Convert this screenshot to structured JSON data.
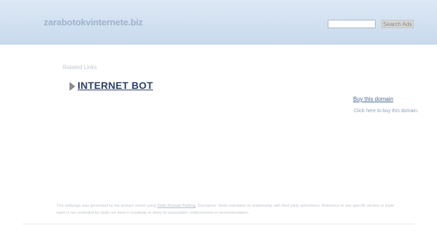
{
  "header": {
    "domain_title": "zarabotokvinternete.biz",
    "search_button_label": "Search Ads",
    "search_value": ""
  },
  "main": {
    "related_heading": "Related Links",
    "links": [
      {
        "label": "INTERNET BOT"
      }
    ]
  },
  "sidebar": {
    "buy_link": "Buy this domain",
    "buy_description": "Click here to buy this domain."
  },
  "footer": {
    "text_before_link": "This webpage was generated by the domain owner using ",
    "link_label": "Sedo Domain Parking",
    "text_after_link": ". Disclaimer: Sedo maintains no relationship with third party advertisers. Reference to any specific service or trade mark is not controlled by Sedo nor does it constitute or imply its association, endorsement or recommendation."
  },
  "colors": {
    "header_bg": "#c9daee",
    "link": "#2a3e66",
    "muted_text": "#c0c6cd"
  }
}
